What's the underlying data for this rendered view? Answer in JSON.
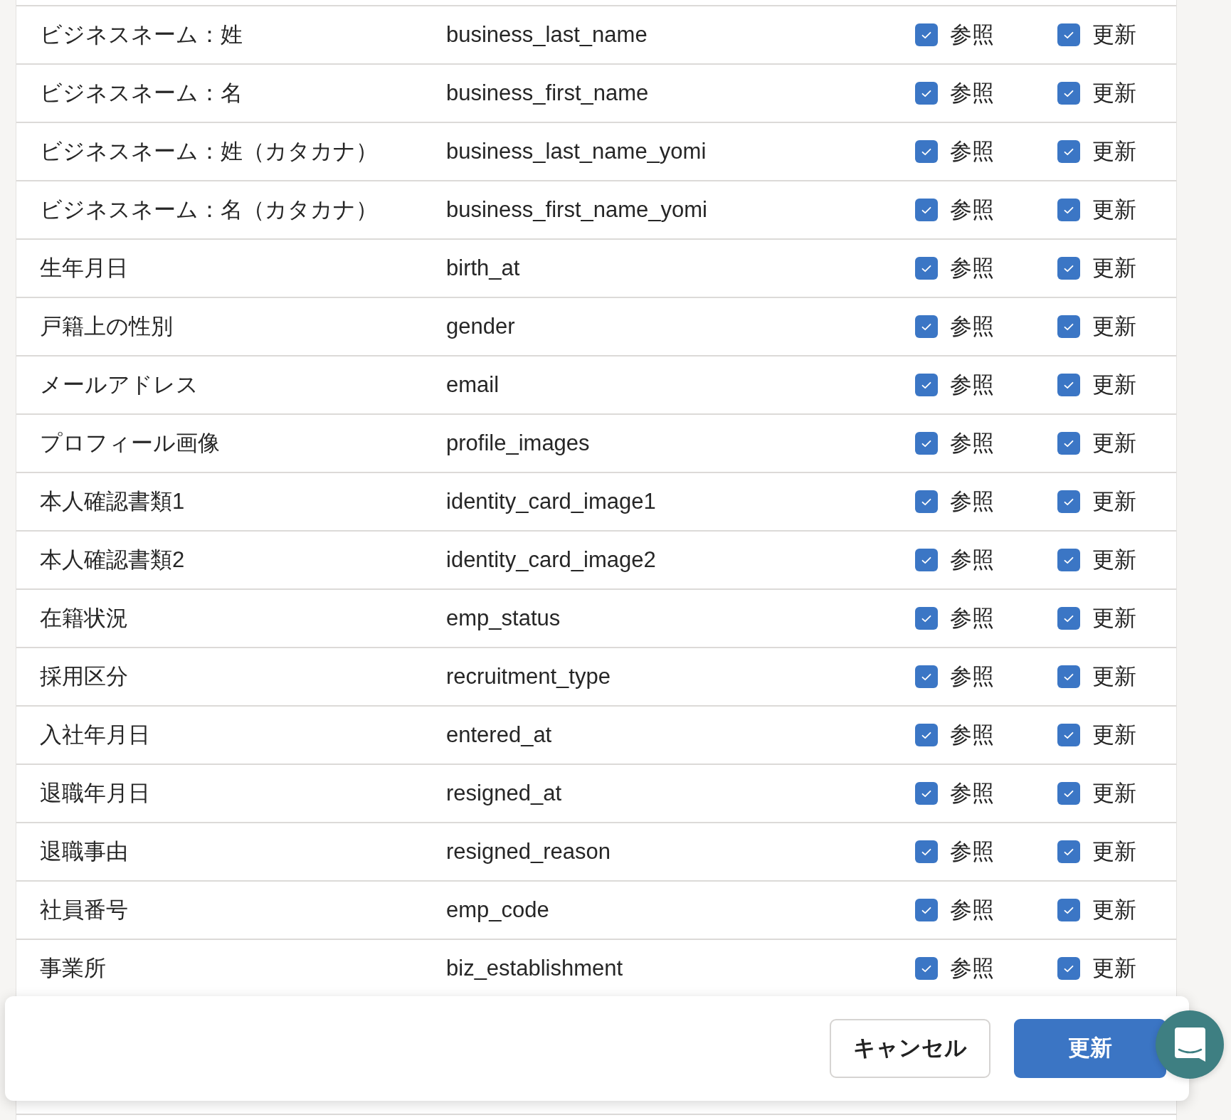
{
  "rows": [
    {
      "label": "ビジネスネーム：姓",
      "field": "business_last_name",
      "permissions": [
        {
          "label": "参照",
          "checked": true
        },
        {
          "label": "更新",
          "checked": true
        }
      ]
    },
    {
      "label": "ビジネスネーム：名",
      "field": "business_first_name",
      "permissions": [
        {
          "label": "参照",
          "checked": true
        },
        {
          "label": "更新",
          "checked": true
        }
      ]
    },
    {
      "label": "ビジネスネーム：姓（カタカナ）",
      "field": "business_last_name_yomi",
      "permissions": [
        {
          "label": "参照",
          "checked": true
        },
        {
          "label": "更新",
          "checked": true
        }
      ]
    },
    {
      "label": "ビジネスネーム：名（カタカナ）",
      "field": "business_first_name_yomi",
      "permissions": [
        {
          "label": "参照",
          "checked": true
        },
        {
          "label": "更新",
          "checked": true
        }
      ]
    },
    {
      "label": "生年月日",
      "field": "birth_at",
      "permissions": [
        {
          "label": "参照",
          "checked": true
        },
        {
          "label": "更新",
          "checked": true
        }
      ]
    },
    {
      "label": "戸籍上の性別",
      "field": "gender",
      "permissions": [
        {
          "label": "参照",
          "checked": true
        },
        {
          "label": "更新",
          "checked": true
        }
      ]
    },
    {
      "label": "メールアドレス",
      "field": "email",
      "permissions": [
        {
          "label": "参照",
          "checked": true
        },
        {
          "label": "更新",
          "checked": true
        }
      ]
    },
    {
      "label": "プロフィール画像",
      "field": "profile_images",
      "permissions": [
        {
          "label": "参照",
          "checked": true
        },
        {
          "label": "更新",
          "checked": true
        }
      ]
    },
    {
      "label": "本人確認書類1",
      "field": "identity_card_image1",
      "permissions": [
        {
          "label": "参照",
          "checked": true
        },
        {
          "label": "更新",
          "checked": true
        }
      ]
    },
    {
      "label": "本人確認書類2",
      "field": "identity_card_image2",
      "permissions": [
        {
          "label": "参照",
          "checked": true
        },
        {
          "label": "更新",
          "checked": true
        }
      ]
    },
    {
      "label": "在籍状況",
      "field": "emp_status",
      "permissions": [
        {
          "label": "参照",
          "checked": true
        },
        {
          "label": "更新",
          "checked": true
        }
      ]
    },
    {
      "label": "採用区分",
      "field": "recruitment_type",
      "permissions": [
        {
          "label": "参照",
          "checked": true
        },
        {
          "label": "更新",
          "checked": true
        }
      ]
    },
    {
      "label": "入社年月日",
      "field": "entered_at",
      "permissions": [
        {
          "label": "参照",
          "checked": true
        },
        {
          "label": "更新",
          "checked": true
        }
      ]
    },
    {
      "label": "退職年月日",
      "field": "resigned_at",
      "permissions": [
        {
          "label": "参照",
          "checked": true
        },
        {
          "label": "更新",
          "checked": true
        }
      ]
    },
    {
      "label": "退職事由",
      "field": "resigned_reason",
      "permissions": [
        {
          "label": "参照",
          "checked": true
        },
        {
          "label": "更新",
          "checked": true
        }
      ]
    },
    {
      "label": "社員番号",
      "field": "emp_code",
      "permissions": [
        {
          "label": "参照",
          "checked": true
        },
        {
          "label": "更新",
          "checked": true
        }
      ]
    },
    {
      "label": "事業所",
      "field": "biz_establishment",
      "permissions": [
        {
          "label": "参照",
          "checked": true
        },
        {
          "label": "更新",
          "checked": true
        }
      ]
    }
  ],
  "footer": {
    "buttons": [
      {
        "label": "キャンセル",
        "kind": "secondary"
      },
      {
        "label": "更新",
        "kind": "primary"
      }
    ]
  }
}
